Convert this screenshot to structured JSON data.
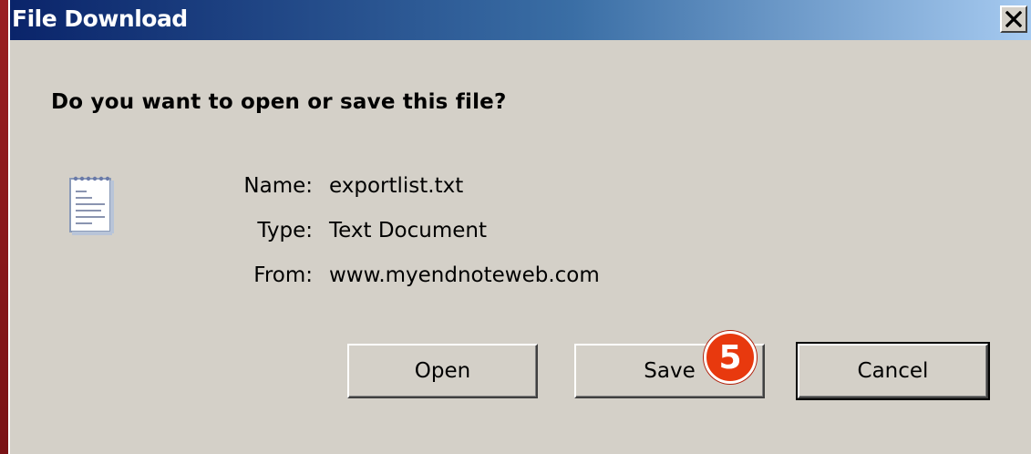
{
  "window": {
    "title": "File Download",
    "close_icon": "close-icon"
  },
  "dialog": {
    "question": "Do you want to open or save this file?",
    "file_icon": "text-document-icon",
    "fields": [
      {
        "label": "Name:",
        "value": "exportlist.txt"
      },
      {
        "label": "Type:",
        "value": "Text Document"
      },
      {
        "label": "From:",
        "value": "www.myendnoteweb.com"
      }
    ],
    "buttons": {
      "open": "Open",
      "save": "Save",
      "cancel": "Cancel"
    },
    "step_badge": "5"
  },
  "colors": {
    "titlebar_start": "#0a246a",
    "titlebar_end": "#a6caf0",
    "dialog_bg": "#d4d0c8",
    "badge": "#e8390e",
    "frame": "#8b1a1a"
  }
}
